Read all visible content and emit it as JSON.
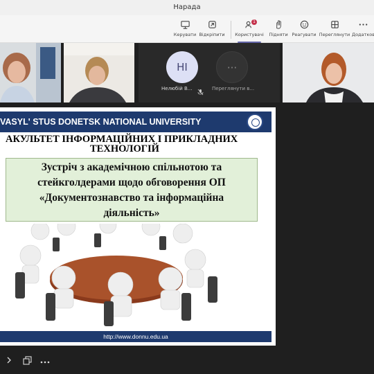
{
  "window": {
    "title": "Нарада"
  },
  "toolbar": {
    "items": [
      {
        "label": "Керувати",
        "icon": "share-screen-icon"
      },
      {
        "label": "Відкріпити",
        "icon": "unpin-icon"
      },
      {
        "label": "Користувачі",
        "icon": "people-icon",
        "badge": "1",
        "active": true
      },
      {
        "label": "Підняти",
        "icon": "raise-hand-icon"
      },
      {
        "label": "Реагувати",
        "icon": "react-smiley-icon"
      },
      {
        "label": "Переглянути",
        "icon": "view-grid-icon"
      },
      {
        "label": "Додатков",
        "icon": "more-icon"
      }
    ]
  },
  "participants": [
    {
      "type": "video"
    },
    {
      "type": "video"
    },
    {
      "type": "avatar",
      "initials": "НІ",
      "name": "Нелюбій В..."
    },
    {
      "type": "avatar",
      "initials": "···",
      "name": "Переглянути в..."
    },
    {
      "type": "video"
    }
  ],
  "slide": {
    "university": "VASYL' STUS DONETSK NATIONAL UNIVERSITY",
    "faculty_line1": "АКУЛЬТЕТ ІНФОРМАЦІЙНИХ І ПРИКЛАДНИХ",
    "faculty_line2": "ТЕХНОЛОГІЙ",
    "meeting_lines": [
      "Зустріч з академічною спільнотою та",
      "стейкголдерами щодо обговорення ОП",
      "«Документознавство та інформаційна",
      "діяльність»"
    ],
    "url": "http://www.donnu.edu.ua"
  },
  "bottombar": {
    "icons": [
      "chevron-right-icon",
      "copy-window-icon",
      "more-icon"
    ]
  },
  "colors": {
    "accent": "#6264a7",
    "badge": "#c4314b",
    "slide_header": "#1e3a6e",
    "meeting_box": "#e2f0d9"
  }
}
